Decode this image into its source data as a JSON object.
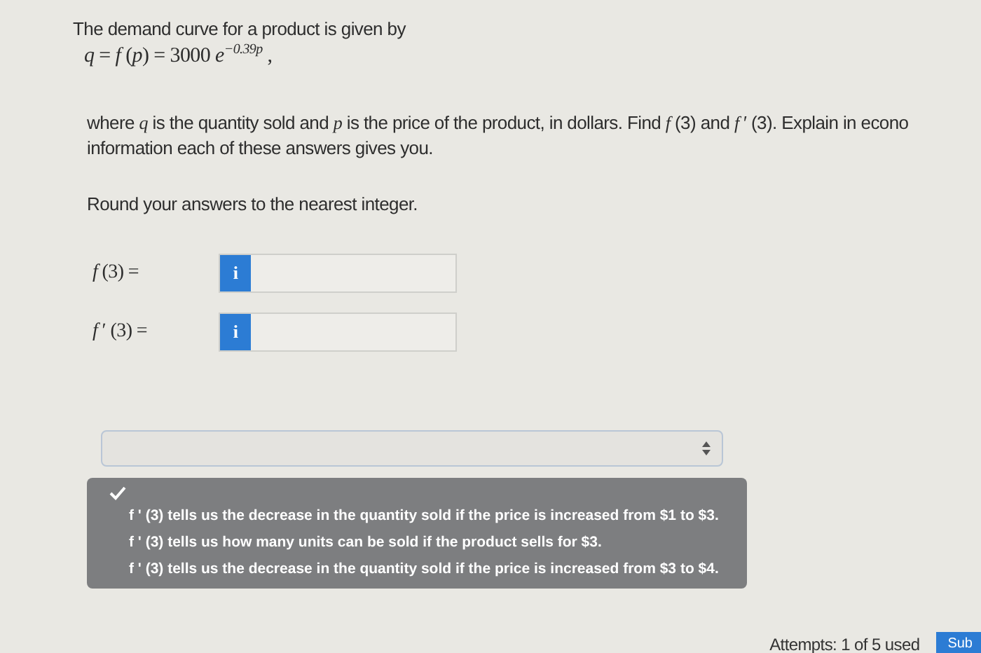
{
  "question": {
    "intro": "The demand curve for a product is given by",
    "equation": "*q* = *f* (*p*) = 3000 *e*$^{−0.39p}$ ,",
    "body": "where *q* is the quantity sold and *p* is the price of the product, in dollars. Find *f* (3) and *f* ′ (3). Explain in econo",
    "body_2": "information each of these answers gives you.",
    "instruction": "Round your answers to the nearest integer."
  },
  "answers": [
    {
      "label": "*f* (3) =",
      "info": "i"
    },
    {
      "label": "*f* ′ (3) =",
      "info": "i"
    }
  ],
  "dropdown": {
    "expanded": true,
    "blank_selected": true,
    "options": [
      {
        "label": "f ' (3) tells us the decrease in the quantity sold if the price is increased from $1 to $3.",
        "selected": false
      },
      {
        "label": "f ' (3) tells us how many units can be sold if the product sells for $3.",
        "selected": false
      },
      {
        "label": "f ' (3) tells us the decrease in the quantity sold if the price is increased from $3 to $4.",
        "selected": false
      }
    ]
  },
  "footer": {
    "attempts": "Attempts: 1 of 5 used",
    "submit": "Sub"
  }
}
